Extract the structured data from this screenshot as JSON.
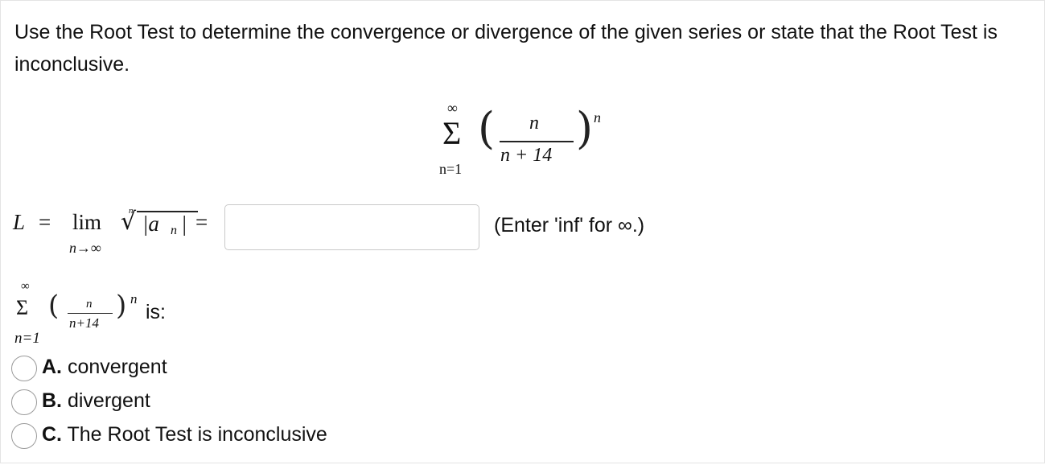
{
  "question": {
    "text": "Use the Root Test to determine the convergence or divergence of the given series or state that the Root Test is inconclusive."
  },
  "series": {
    "sum_symbol": "Σ",
    "upper": "∞",
    "lower": "n=1",
    "numerator": "n",
    "denominator": "n + 14",
    "exponent": "n",
    "left_paren": "(",
    "right_paren": ")"
  },
  "limit": {
    "L": "L",
    "equals": "=",
    "lim": "lim",
    "sub": "n→∞",
    "root_index": "n",
    "radical": "√",
    "abs_expr": "|a",
    "abs_sub": "n",
    "abs_close": "|",
    "equals2": "=",
    "input_value": "",
    "hint": "(Enter 'inf' for ∞.)"
  },
  "series_small": {
    "upper": "∞",
    "sum_symbol": "Σ",
    "lower": "n=1",
    "numerator": "n",
    "denominator": "n+14",
    "exponent": "n",
    "left_paren": "(",
    "right_paren": ")",
    "suffix": "is:"
  },
  "choices": [
    {
      "letter": "A.",
      "text": "convergent"
    },
    {
      "letter": "B.",
      "text": "divergent"
    },
    {
      "letter": "C.",
      "text": "The Root Test is inconclusive"
    }
  ]
}
